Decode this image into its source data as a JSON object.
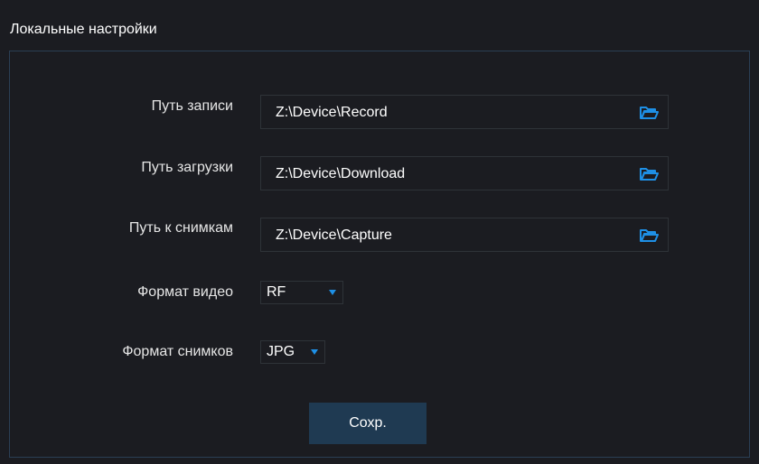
{
  "title": "Локальные настройки",
  "fields": {
    "record_path": {
      "label": "Путь записи",
      "value": "Z:\\Device\\Record",
      "icon": "folder-icon"
    },
    "download_path": {
      "label": "Путь загрузки",
      "value": "Z:\\Device\\Download",
      "icon": "folder-icon"
    },
    "capture_path": {
      "label": "Путь к снимкам",
      "value": "Z:\\Device\\Capture",
      "icon": "folder-icon"
    },
    "video_format": {
      "label": "Формат видео",
      "value": "RF"
    },
    "snapshot_format": {
      "label": "Формат снимков",
      "value": "JPG"
    }
  },
  "save_label": "Сохр.",
  "colors": {
    "accent": "#1e90e6",
    "button_bg": "#1f3a52",
    "border": "#2a3f54",
    "background": "#1b1c21"
  }
}
